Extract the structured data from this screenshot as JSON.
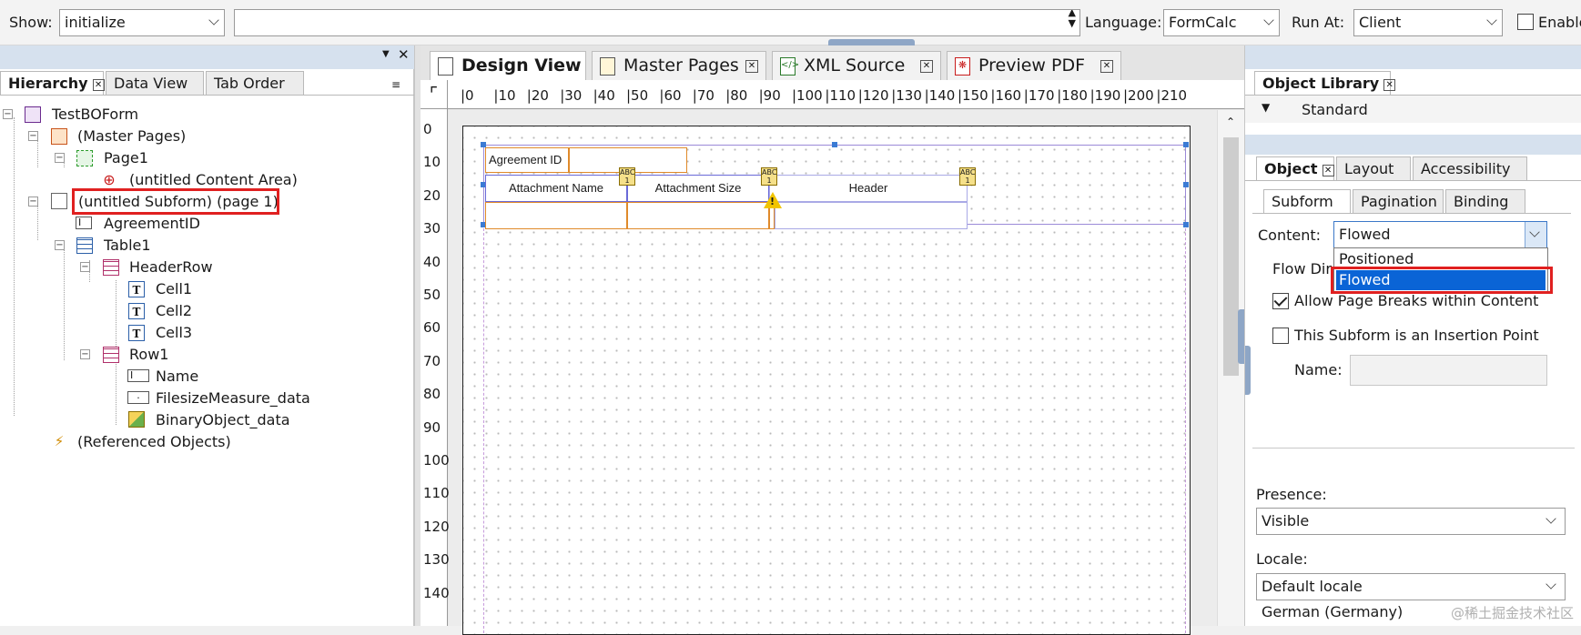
{
  "toolbar": {
    "show_label": "Show:",
    "show_value": "initialize",
    "script_value": "",
    "language_label": "Language:",
    "language_value": "FormCalc",
    "run_at_label": "Run At:",
    "run_at_value": "Client",
    "enable_label": "Enable"
  },
  "left_panel": {
    "tabs": [
      "Hierarchy",
      "Data View",
      "Tab Order"
    ],
    "tree": [
      {
        "label": "TestBOForm",
        "icon": "form-icon"
      },
      {
        "label": "(Master Pages)",
        "icon": "master-pages-icon"
      },
      {
        "label": "Page1",
        "icon": "page-icon"
      },
      {
        "label": "(untitled Content Area)",
        "icon": "content-area-icon"
      },
      {
        "label": "(untitled Subform) (page 1)",
        "icon": "subform-icon"
      },
      {
        "label": "AgreementID",
        "icon": "text-field-icon"
      },
      {
        "label": "Table1",
        "icon": "table-icon"
      },
      {
        "label": "HeaderRow",
        "icon": "row-icon"
      },
      {
        "label": "Cell1",
        "icon": "text-icon"
      },
      {
        "label": "Cell2",
        "icon": "text-icon"
      },
      {
        "label": "Cell3",
        "icon": "text-icon"
      },
      {
        "label": "Row1",
        "icon": "row-icon"
      },
      {
        "label": "Name",
        "icon": "text-field-icon"
      },
      {
        "label": "FilesizeMeasure_data",
        "icon": "numeric-field-icon"
      },
      {
        "label": "BinaryObject_data",
        "icon": "image-field-icon"
      },
      {
        "label": "(Referenced Objects)",
        "icon": "referenced-objects-icon"
      }
    ]
  },
  "center": {
    "tabs": [
      "Design View",
      "Master Pages",
      "XML Source",
      "Preview PDF"
    ],
    "ruler_top": [
      "0",
      "10",
      "20",
      "30",
      "40",
      "50",
      "60",
      "70",
      "80",
      "90",
      "100",
      "110",
      "120",
      "130",
      "140",
      "150",
      "160",
      "170",
      "180",
      "190",
      "200",
      "210"
    ],
    "ruler_left": [
      "0",
      "10",
      "20",
      "30",
      "40",
      "50",
      "60",
      "70",
      "80",
      "90",
      "100",
      "110",
      "120",
      "130",
      "140"
    ],
    "form": {
      "agreement_label": "Agreement ID",
      "col1": "Attachment Name",
      "col2": "Attachment Size",
      "col3": "Header"
    }
  },
  "right_panel": {
    "library_title": "Object Library",
    "library_section": "Standard",
    "tabs": [
      "Object",
      "Layout",
      "Accessibility"
    ],
    "subtabs": [
      "Subform",
      "Pagination",
      "Binding"
    ],
    "content_label": "Content:",
    "content_value": "Flowed",
    "content_options": [
      "Positioned",
      "Flowed"
    ],
    "flow_direction_label": "Flow Dire",
    "allow_breaks_label": "Allow Page Breaks within Content",
    "insertion_point_label": "This Subform is an Insertion Point",
    "name_label": "Name:",
    "name_value": "",
    "presence_label": "Presence:",
    "presence_value": "Visible",
    "locale_label": "Locale:",
    "locale_value": "Default locale",
    "locale_hint": "German (Germany)"
  },
  "watermark": "@稀土掘金技术社区"
}
